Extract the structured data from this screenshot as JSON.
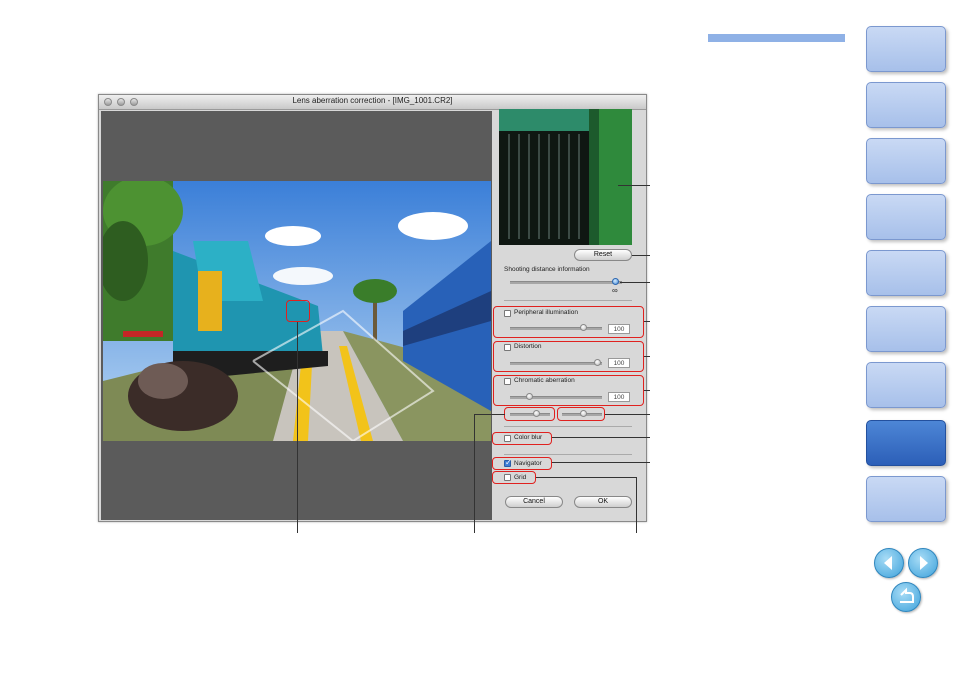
{
  "dialog": {
    "title": "Lens aberration correction - [IMG_1001.CR2]"
  },
  "controls": {
    "reset_label": "Reset",
    "shooting_distance_label": "Shooting distance information",
    "infinity_symbol": "∞",
    "peripheral_label": "Peripheral illumination",
    "peripheral_value": "100",
    "distortion_label": "Distortion",
    "distortion_value": "100",
    "chromatic_label": "Chromatic aberration",
    "chromatic_value": "100",
    "color_blur_label": "Color blur",
    "navigator_label": "Navigator",
    "navigator_checked": true,
    "grid_label": "Grid",
    "cancel_label": "Cancel",
    "ok_label": "OK"
  },
  "colors": {
    "callout": "#e0211f",
    "nav_tab": "#a7c0ea",
    "nav_tab_active": "#2c5fb8",
    "header_bar": "#8fb1e6"
  },
  "icons": {
    "nav_prev": "arrow-left-icon",
    "nav_next": "arrow-right-icon",
    "nav_return": "return-icon"
  }
}
